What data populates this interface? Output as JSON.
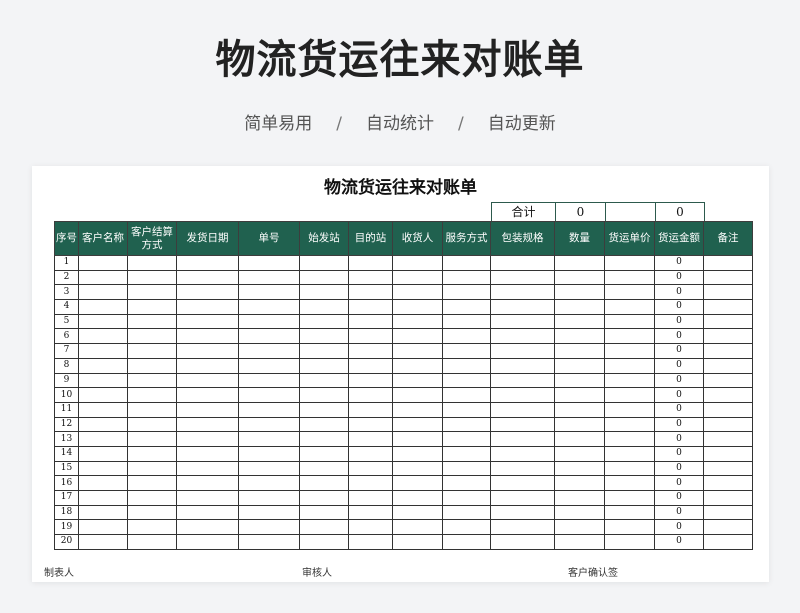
{
  "hero": {
    "title": "物流货运往来对账单",
    "subtitle_items": [
      "简单易用",
      "自动统计",
      "自动更新"
    ],
    "separator": "/"
  },
  "sheet": {
    "title": "物流货运往来对账单",
    "total_label": "合计",
    "total_quantity": "0",
    "total_amount": "0",
    "headers": [
      "序号",
      "客户名称",
      "客户结算方式",
      "发货日期",
      "单号",
      "始发站",
      "目的站",
      "收货人",
      "服务方式",
      "包装规格",
      "数量",
      "货运单价",
      "货运金额",
      "备注"
    ],
    "rows": [
      {
        "no": "1",
        "amount": "0"
      },
      {
        "no": "2",
        "amount": "0"
      },
      {
        "no": "3",
        "amount": "0"
      },
      {
        "no": "4",
        "amount": "0"
      },
      {
        "no": "5",
        "amount": "0"
      },
      {
        "no": "6",
        "amount": "0"
      },
      {
        "no": "7",
        "amount": "0"
      },
      {
        "no": "8",
        "amount": "0"
      },
      {
        "no": "9",
        "amount": "0"
      },
      {
        "no": "10",
        "amount": "0"
      },
      {
        "no": "11",
        "amount": "0"
      },
      {
        "no": "12",
        "amount": "0"
      },
      {
        "no": "13",
        "amount": "0"
      },
      {
        "no": "14",
        "amount": "0"
      },
      {
        "no": "15",
        "amount": "0"
      },
      {
        "no": "16",
        "amount": "0"
      },
      {
        "no": "17",
        "amount": "0"
      },
      {
        "no": "18",
        "amount": "0"
      },
      {
        "no": "19",
        "amount": "0"
      },
      {
        "no": "20",
        "amount": "0"
      }
    ],
    "footer": [
      "制表人",
      "审核人",
      "客户确认签"
    ]
  },
  "colors": {
    "header_bg": "#20614f",
    "page_bg": "#f3f4f6"
  }
}
